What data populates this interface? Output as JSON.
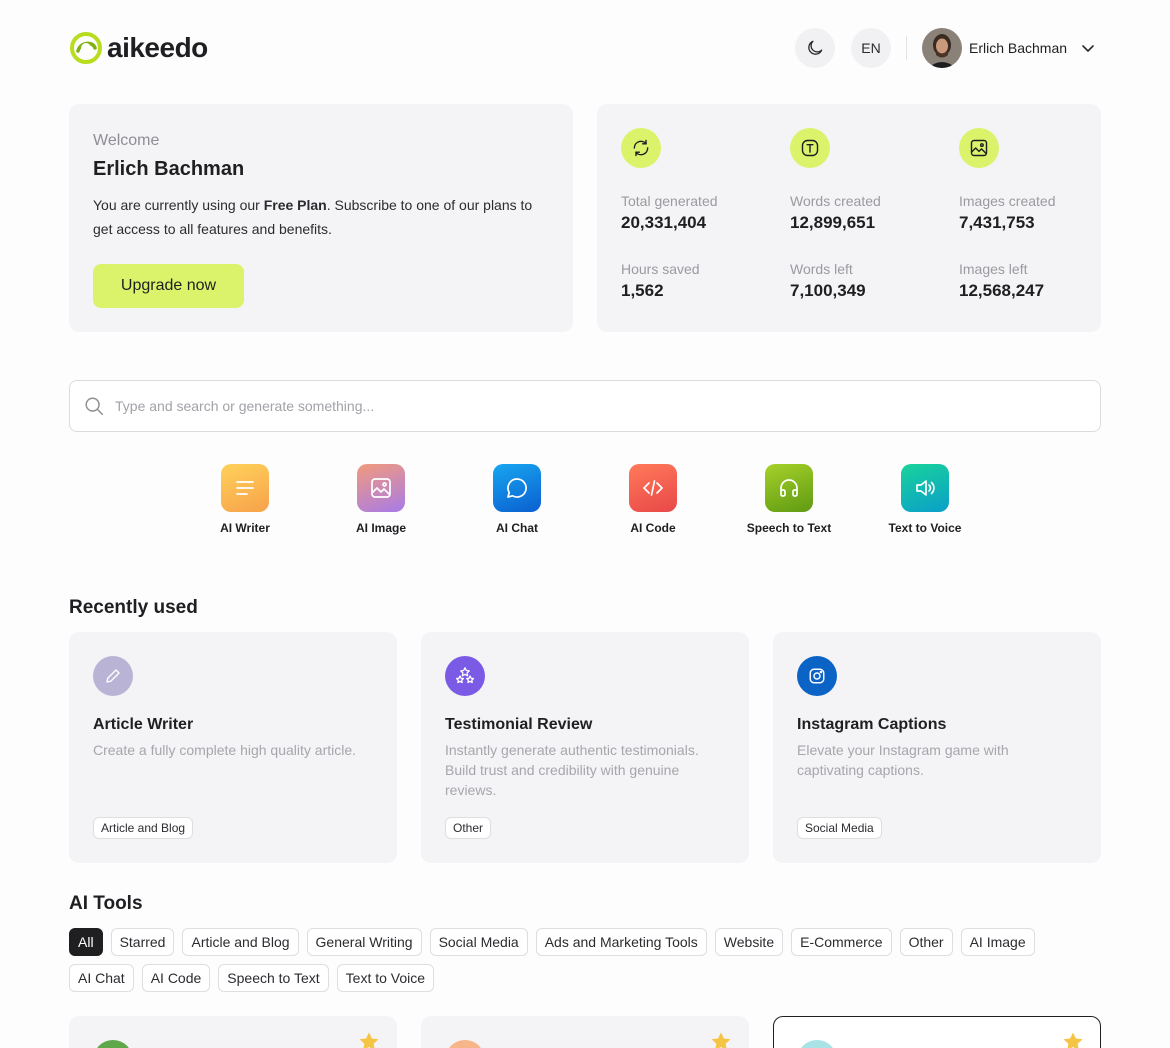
{
  "header": {
    "logo_text": "aikeedo",
    "theme_toggle": "moon-icon",
    "language": "EN",
    "user_name": "Erlich Bachman"
  },
  "welcome": {
    "greeting": "Welcome",
    "name": "Erlich Bachman",
    "plan_prefix": "You are currently using our ",
    "plan_name": "Free Plan",
    "plan_suffix": ". Subscribe to one of our plans to get access to all features and benefits.",
    "upgrade_label": "Upgrade now"
  },
  "stats": {
    "total_generated": {
      "label": "Total generated",
      "value": "20,331,404"
    },
    "words_created": {
      "label": "Words created",
      "value": "12,899,651"
    },
    "images_created": {
      "label": "Images created",
      "value": "7,431,753"
    },
    "hours_saved": {
      "label": "Hours saved",
      "value": "1,562"
    },
    "words_left": {
      "label": "Words left",
      "value": "7,100,349"
    },
    "images_left": {
      "label": "Images left",
      "value": "12,568,247"
    }
  },
  "search": {
    "placeholder": "Type and search or generate something..."
  },
  "quick_tools": [
    {
      "label": "AI Writer",
      "icon": "lines-icon"
    },
    {
      "label": "AI Image",
      "icon": "image-icon"
    },
    {
      "label": "AI Chat",
      "icon": "chat-icon"
    },
    {
      "label": "AI Code",
      "icon": "code-icon"
    },
    {
      "label": "Speech to Text",
      "icon": "headphones-icon"
    },
    {
      "label": "Text to Voice",
      "icon": "speaker-icon"
    }
  ],
  "recent": {
    "title": "Recently used",
    "items": [
      {
        "title": "Article Writer",
        "desc": "Create a fully complete high quality article.",
        "tag": "Article and Blog",
        "color": "#b9b4d6"
      },
      {
        "title": "Testimonial Review",
        "desc": "Instantly generate authentic testimonials. Build trust and credibility with genuine reviews.",
        "tag": "Other",
        "color": "#7b5be6"
      },
      {
        "title": "Instagram Captions",
        "desc": "Elevate your Instagram game with captivating captions.",
        "tag": "Social Media",
        "color": "#0b63c5"
      }
    ]
  },
  "tools": {
    "title": "AI Tools",
    "filters": [
      "All",
      "Starred",
      "Article and Blog",
      "General Writing",
      "Social Media",
      "Ads and Marketing Tools",
      "Website",
      "E-Commerce",
      "Other",
      "AI Image",
      "AI Chat",
      "AI Code",
      "Speech to Text",
      "Text to Voice"
    ]
  },
  "colors": {
    "accent": "#dbf36a",
    "card_bg": "#f4f4f6"
  }
}
